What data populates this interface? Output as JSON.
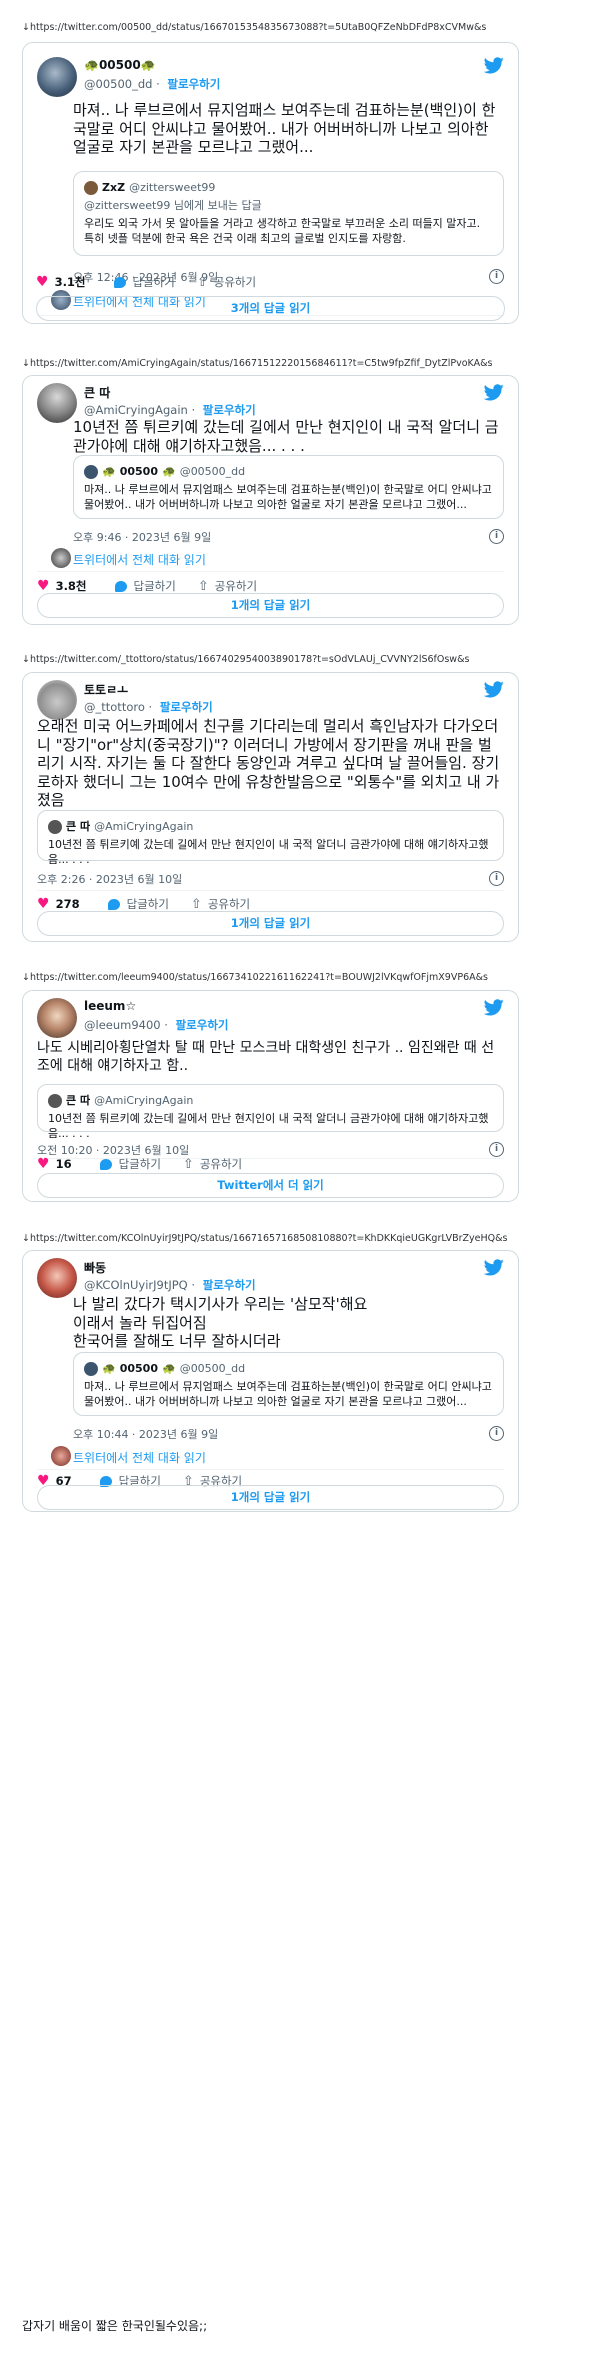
{
  "tweets": [
    {
      "url": "↓https://twitter.com/00500_dd/status/1667015354835673088?t=5UtaB0QFZeNbDFdP8xCVMw&s",
      "author": {
        "name": "00500",
        "name_emoji": "🐢",
        "handle": "@00500_dd",
        "follow": "팔로우하기"
      },
      "text": "마져.. 나 루브르에서 뮤지엄패스 보여주는데 검표하는분(백인)이 한국말로 어디 안씨냐고 물어봤어.. 내가 어버버하니까 나보고 의아한 얼굴로 자기 본관을 모르냐고 그랬어...",
      "quote": {
        "name": "ZxZ",
        "handle": "@zittersweet99",
        "sub": "@zittersweet99 님에게 보내는 답글",
        "text": "우리도 외국 가서 못 알아들을 거라고 생각하고 한국말로 부끄러운 소리 떠들지 말자고. 특히 넷플 덕분에 한국 욕은 건국 이래 최고의 글로벌 인지도를 자랑함."
      },
      "time": "오후 12:46 · 2023년 6월 9일",
      "thread": "트위터에서 전체 대화 읽기",
      "likes": "3.1천",
      "reply": "답글하기",
      "share": "공유하기",
      "read_button": "3개의 답글 읽기"
    },
    {
      "url": "↓https://twitter.com/AmiCryingAgain/status/1667151222015684611?t=C5tw9fpZfif_DytZlPvoKA&s",
      "author": {
        "name": "큰 따",
        "handle": "@AmiCryingAgain",
        "follow": "팔로우하기"
      },
      "text": "10년전 쯤 튀르키예 갔는데 길에서 만난 현지인이 내 국적 알더니 금관가야에 대해 얘기하자고했음...  . . .",
      "quote": {
        "name": "00500",
        "name_emoji": "🐢",
        "handle": "@00500_dd",
        "text": "마져.. 나 루브르에서 뮤지엄패스 보여주는데 검표하는분(백인)이 한국말로 어디 안씨냐고 물어봤어.. 내가 어버버하니까 나보고 의아한 얼굴로 자기 본관을 모르냐고 그랬어..."
      },
      "time": "오후 9:46 · 2023년 6월 9일",
      "thread": "트위터에서 전체 대화 읽기",
      "likes": "3.8천",
      "reply": "답글하기",
      "share": "공유하기",
      "read_button": "1개의 답글 읽기"
    },
    {
      "url": "↓https://twitter.com/_ttottoro/status/1667402954003890178?t=sOdVLAUj_CVVNY2lS6fOsw&s",
      "author": {
        "name": "토토ㄹㅗ",
        "handle": "@_ttottoro",
        "follow": "팔로우하기"
      },
      "text": "오래전 미국 어느카페에서 친구를 기다리는데 멀리서 흑인남자가 다가오더니 \"장기\"or\"상치(중국장기)\"? 이러더니 가방에서 장기판을 꺼내 판을 벌리기 시작. 자기는 둘 다 잘한다 동양인과 겨루고 싶다며 날 끌어들임. 장기로하자 했더니 그는 10여수 만에 유창한발음으로 \"외통수\"를 외치고 내 가졌음",
      "quote": {
        "name": "큰 따",
        "handle": "@AmiCryingAgain",
        "text": "10년전 쯤 튀르키예 갔는데 길에서 만난 현지인이 내 국적 알더니 금관가야에 대해 얘기하자고했음...  . . ."
      },
      "time": "오후 2:26 · 2023년 6월 10일",
      "likes": "278",
      "reply": "답글하기",
      "share": "공유하기",
      "read_button": "1개의 답글 읽기"
    },
    {
      "url": "↓https://twitter.com/leeum9400/status/1667341022161162241?t=BOUWJ2lVKqwfOFjmX9VP6A&s",
      "author": {
        "name": "leeum☆",
        "handle": "@leeum9400",
        "follow": "팔로우하기"
      },
      "text": "나도 시베리아횡단열차 탈 때 만난 모스크바 대학생인 친구가 .. 임진왜란 때 선조에 대해 얘기하자고 함..",
      "quote": {
        "name": "큰 따",
        "handle": "@AmiCryingAgain",
        "text": "10년전 쯤 튀르키예 갔는데 길에서 만난 현지인이 내 국적 알더니 금관가야에 대해 얘기하자고했음...  . . ."
      },
      "time": "오전 10:20 · 2023년 6월 10일",
      "likes": "16",
      "reply": "답글하기",
      "share": "공유하기",
      "read_button": "Twitter에서 더 읽기"
    },
    {
      "url": "↓https://twitter.com/KCOlnUyirJ9tJPQ/status/1667165716850810880?t=KhDKKqieUGKgrLVBrZyeHQ&s",
      "author": {
        "name": "빠동",
        "handle": "@KCOlnUyirJ9tJPQ",
        "follow": "팔로우하기"
      },
      "text": "나 발리 갔다가 택시기사가 우리는 '삼모작'해요\n이래서 놀라 뒤집어짐\n한국어를 잘해도 너무 잘하시더라",
      "quote": {
        "name": "00500",
        "name_emoji": "🐢",
        "handle": "@00500_dd",
        "text": "마져.. 나 루브르에서 뮤지엄패스 보여주는데 검표하는분(백인)이 한국말로 어디 안씨냐고 물어봤어.. 내가 어버버하니까 나보고 의아한 얼굴로 자기 본관을 모르냐고 그랬어..."
      },
      "time": "오후 10:44 · 2023년 6월 9일",
      "thread": "트위터에서 전체 대화 읽기",
      "likes": "67",
      "reply": "답글하기",
      "share": "공유하기",
      "read_button": "1개의 답글 읽기"
    }
  ],
  "caption": "갑자기 배움이 짧은 한국인될수있음;;",
  "icons": {
    "bird": "twitter-bird-icon",
    "info": "info-icon",
    "heart": "heart-icon",
    "reply": "reply-icon",
    "share": "share-icon"
  },
  "colors": {
    "accent": "#1d9bf0",
    "heart": "#f91880",
    "muted": "#536471",
    "border": "#cfd9de"
  }
}
